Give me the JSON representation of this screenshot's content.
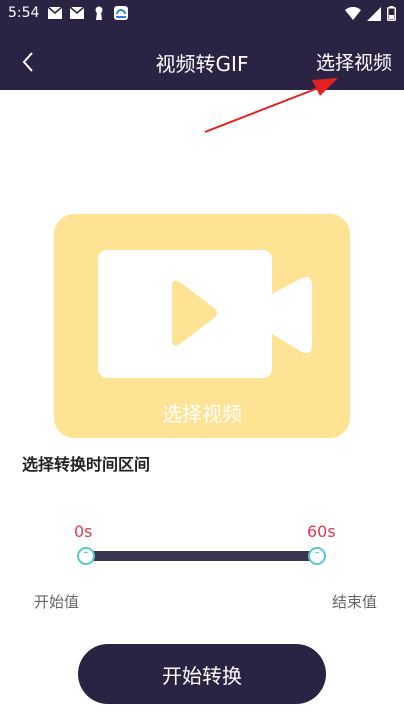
{
  "status_bar": {
    "time": "5:54"
  },
  "header": {
    "title": "视频转GIF",
    "select_video_label": "选择视频"
  },
  "video_card": {
    "label": "选择视频"
  },
  "range": {
    "heading": "选择转换时间区间",
    "start_value": "0s",
    "end_value": "60s",
    "start_label": "开始值",
    "end_label": "结束值"
  },
  "start_button": {
    "label": "开始转换"
  },
  "colors": {
    "header_bg": "#2a2343",
    "card_bg": "#ffe394",
    "accent_red": "#e0394f",
    "handle_border": "#57c7d1",
    "slider_track": "#3a3550"
  }
}
